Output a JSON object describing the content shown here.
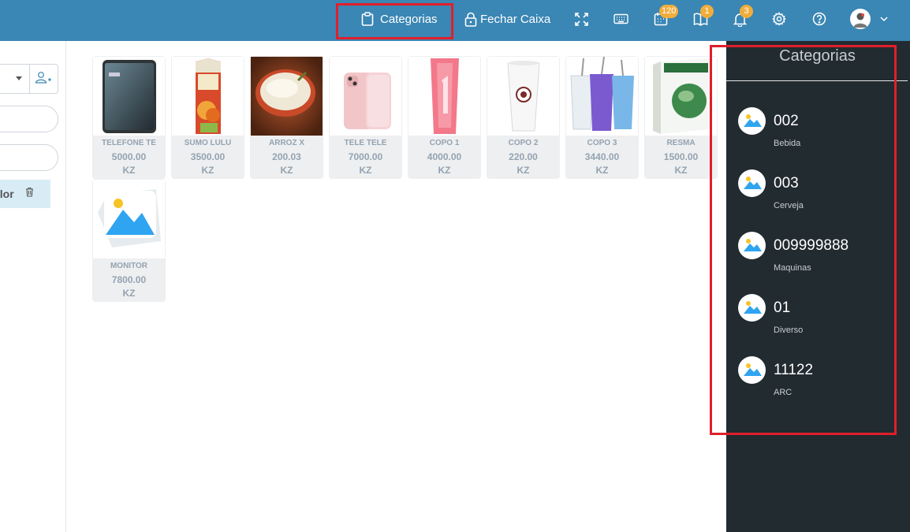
{
  "topbar": {
    "categorias_label": "Categorias",
    "fechar_caixa_label": "Fechar Caixa",
    "badges": {
      "calendar": "120",
      "book": "1",
      "bell": "3"
    },
    "accent": "#3a86b4",
    "highlight": "#e01f2b"
  },
  "left": {
    "valor_label": "alor"
  },
  "products": [
    {
      "name": "TELEFONE TE",
      "price": "5000.00",
      "currency": "KZ",
      "image": "phone"
    },
    {
      "name": "SUMO LULU",
      "price": "3500.00",
      "currency": "KZ",
      "image": "juice-carton"
    },
    {
      "name": "ARROZ X",
      "price": "200.03",
      "currency": "KZ",
      "image": "rice-bowl"
    },
    {
      "name": "TELE TELE",
      "price": "7000.00",
      "currency": "KZ",
      "image": "iphone"
    },
    {
      "name": "COPO 1",
      "price": "4000.00",
      "currency": "KZ",
      "image": "pink-cup"
    },
    {
      "name": "COPO 2",
      "price": "220.00",
      "currency": "KZ",
      "image": "white-cup"
    },
    {
      "name": "COPO 3",
      "price": "3440.00",
      "currency": "KZ",
      "image": "plastic-tumblers"
    },
    {
      "name": "RESMA",
      "price": "1500.00",
      "currency": "KZ",
      "image": "paper-ream"
    },
    {
      "name": "MONITOR",
      "price": "7800.00",
      "currency": "KZ",
      "image": "placeholder"
    }
  ],
  "sidebar": {
    "title": "Categorias",
    "categories": [
      {
        "code": "002",
        "name": "Bebida"
      },
      {
        "code": "003",
        "name": "Cerveja"
      },
      {
        "code": "009999888",
        "name": "Maquinas"
      },
      {
        "code": "01",
        "name": "Diverso"
      },
      {
        "code": "11122",
        "name": "ARC"
      }
    ]
  }
}
